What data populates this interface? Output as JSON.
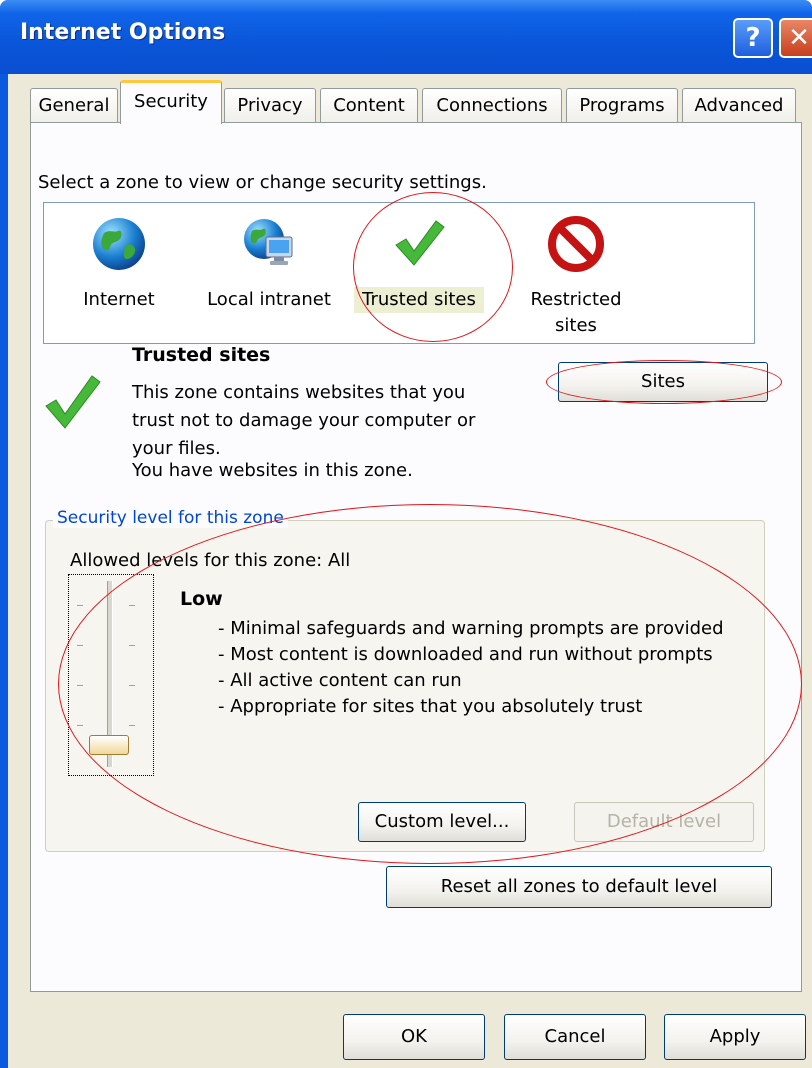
{
  "window": {
    "title": "Internet Options",
    "help_glyph": "?",
    "close_glyph": "✕",
    "accent_color": "#0a55d9"
  },
  "tabs": [
    {
      "label": "General"
    },
    {
      "label": "Security",
      "active": true
    },
    {
      "label": "Privacy"
    },
    {
      "label": "Content"
    },
    {
      "label": "Connections"
    },
    {
      "label": "Programs"
    },
    {
      "label": "Advanced"
    }
  ],
  "security": {
    "select_zone_label": "Select a zone to view or change security settings.",
    "zones": [
      {
        "label": "Internet",
        "icon": "globe-icon"
      },
      {
        "label": "Local intranet",
        "icon": "intranet-globe-icon"
      },
      {
        "label": "Trusted sites",
        "icon": "checkmark-icon",
        "selected": true
      },
      {
        "label": "Restricted sites",
        "icon": "no-entry-icon"
      }
    ],
    "zone_info": {
      "title": "Trusted sites",
      "description": "This zone contains websites that you trust not to damage your computer or your files.",
      "note": "You have websites in this zone."
    },
    "sites_button": "Sites",
    "level_group_label": "Security level for this zone",
    "allowed_levels": "Allowed levels for this zone: All",
    "level_name": "Low",
    "level_bullets": [
      "- Minimal safeguards and warning prompts are provided",
      "- Most content is downloaded and run without prompts",
      "- All active content can run",
      "- Appropriate for sites that you absolutely trust"
    ],
    "custom_level_button": "Custom level...",
    "default_level_button": "Default level",
    "reset_all_button": "Reset all zones to default level"
  },
  "footer": {
    "ok_button": "OK",
    "cancel_button": "Cancel",
    "apply_button": "Apply"
  },
  "annotation_color": "#e0161a"
}
